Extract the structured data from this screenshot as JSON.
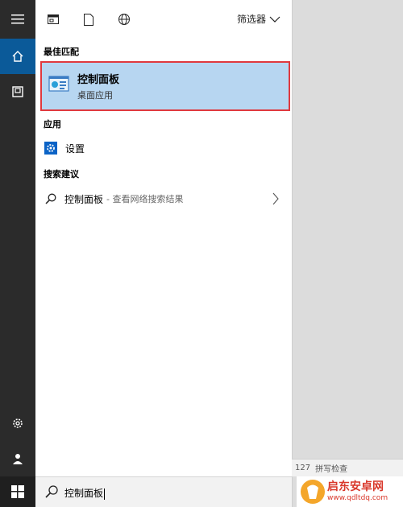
{
  "rail": {
    "items": [
      {
        "name": "menu"
      },
      {
        "name": "home"
      },
      {
        "name": "documents"
      },
      {
        "name": "settings"
      },
      {
        "name": "user"
      }
    ]
  },
  "toolbar": {
    "filter_label": "筛选器"
  },
  "sections": {
    "best_match": "最佳匹配",
    "apps": "应用",
    "suggestions": "搜索建议"
  },
  "best_match": {
    "title": "控制面板",
    "subtitle": "桌面应用"
  },
  "apps": [
    {
      "label": "设置"
    }
  ],
  "suggestions": [
    {
      "label": "控制面板",
      "hint": "- 查看网络搜索结果"
    }
  ],
  "search": {
    "value": "控制面板"
  },
  "background_strip": {
    "items": [
      "127",
      "拼写检查"
    ]
  },
  "watermark": {
    "title": "启东安卓网",
    "url": "www.qdltdq.com"
  },
  "colors": {
    "accent": "#0b5a99",
    "highlight": "#b7d6f1",
    "selection_border": "#e0393e"
  }
}
